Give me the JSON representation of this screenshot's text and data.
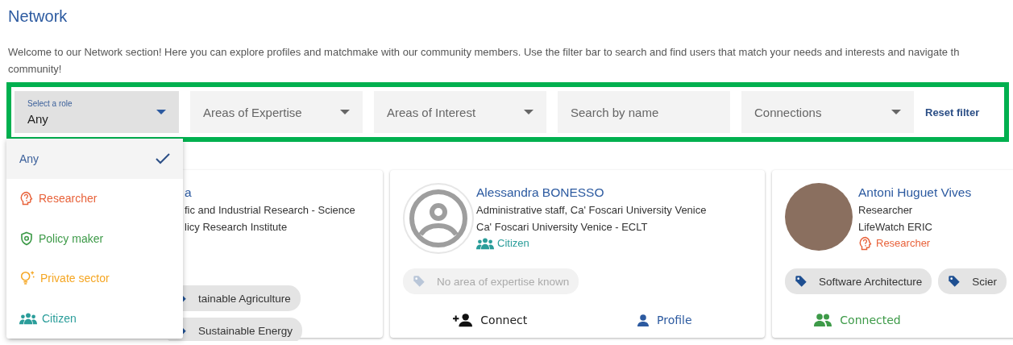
{
  "title": "Network",
  "intro_lines": [
    "Welcome to our Network section! Here you can explore profiles and matchmake with our community members. Use the filter bar to search and find users that match your needs and interests and navigate th",
    "community!"
  ],
  "filters": [
    {
      "kind": "select",
      "label": "Select a role",
      "value": "Any",
      "focused": true
    },
    {
      "kind": "select",
      "placeholder": "Areas of Expertise",
      "focused": false
    },
    {
      "kind": "select",
      "placeholder": "Areas of Interest",
      "focused": false
    },
    {
      "kind": "text",
      "placeholder": "Search by name",
      "focused": false
    },
    {
      "kind": "select",
      "placeholder": "Connections",
      "focused": false
    },
    {
      "kind": "reset",
      "label": "Reset filter"
    }
  ],
  "role_menu": [
    {
      "label": "Any",
      "kind": "any",
      "selected": true
    },
    {
      "label": "Researcher",
      "kind": "researcher",
      "selected": false
    },
    {
      "label": "Policy maker",
      "kind": "policy",
      "selected": false
    },
    {
      "label": "Private sector",
      "kind": "private",
      "selected": false
    },
    {
      "label": "Citizen",
      "kind": "citizen",
      "selected": false
    }
  ],
  "cards": [
    {
      "kind": "covered",
      "name": "a",
      "lines": [
        "fic and Industrial Research - Science",
        "licy Research Institute"
      ],
      "tags": [
        "tainable Agriculture",
        "Sustainable Energy"
      ]
    },
    {
      "kind": "default",
      "name": "Alessandra BONESSO",
      "lines": [
        "Administrative staff, Ca' Foscari University Venice",
        "Ca' Foscari University Venice - ECLT"
      ],
      "role": {
        "kind": "citizen",
        "label": "Citizen"
      },
      "no_tags": "No area of expertise known",
      "actions": [
        {
          "kind": "connect",
          "label": "Connect"
        },
        {
          "kind": "profile",
          "label": "Profile"
        }
      ]
    },
    {
      "kind": "photo",
      "name": "Antoni Huguet Vives",
      "lines": [
        "Researcher",
        "LifeWatch ERIC"
      ],
      "role": {
        "kind": "researcher",
        "label": "Researcher"
      },
      "tags": [
        "Software Architecture",
        "Scier"
      ],
      "actions": [
        {
          "kind": "connected",
          "label": "Connected"
        }
      ]
    }
  ]
}
